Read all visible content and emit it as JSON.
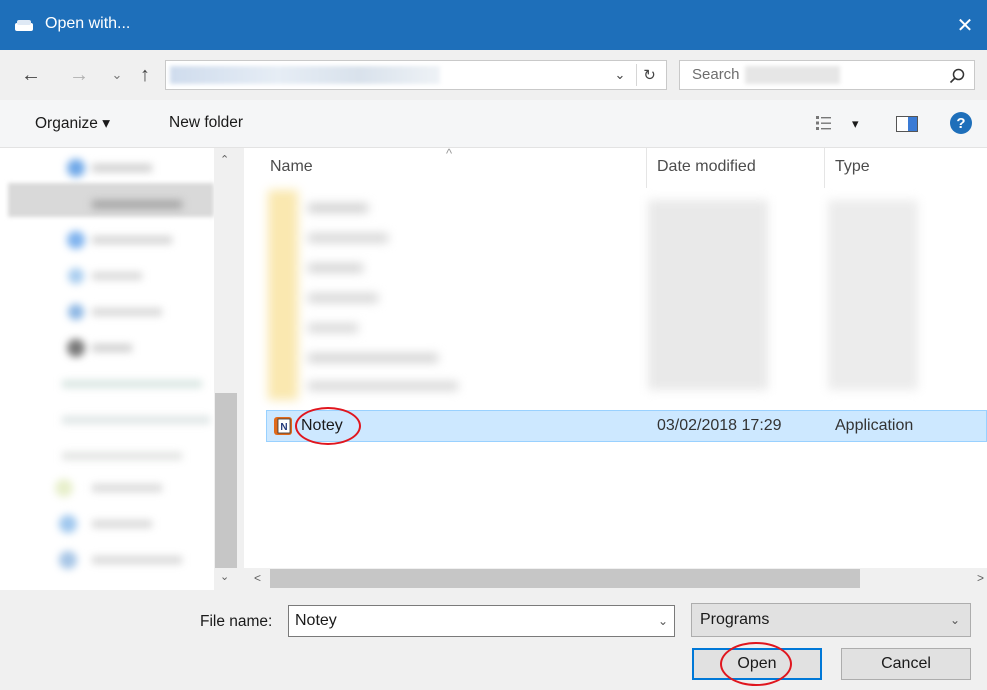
{
  "window": {
    "title": "Open with...",
    "close_glyph": "✕"
  },
  "address": {
    "back": "←",
    "forward": "→",
    "recent": "⌄",
    "up": "↑",
    "dropdown": "⌄",
    "refresh": "↻"
  },
  "search": {
    "placeholder": "Search"
  },
  "toolbar": {
    "organize": "Organize ▾",
    "new_folder": "New folder",
    "view_dropdown": "▾",
    "help": "?"
  },
  "columns": {
    "name": "Name",
    "date_modified": "Date modified",
    "type": "Type",
    "sort_glyph": "^"
  },
  "files": [
    {
      "name": "Notey",
      "date_modified": "03/02/2018 17:29",
      "type": "Application",
      "selected": true,
      "icon": "notey-app-icon",
      "icon_letter": "N"
    }
  ],
  "bottom": {
    "file_name_label": "File name:",
    "file_name_value": "Notey",
    "filter_value": "Programs",
    "open_label": "Open",
    "cancel_label": "Cancel"
  },
  "colors": {
    "titlebar": "#1e6fba",
    "selection": "#cde8ff",
    "annotation": "#e0161e",
    "focus": "#0078d7"
  }
}
